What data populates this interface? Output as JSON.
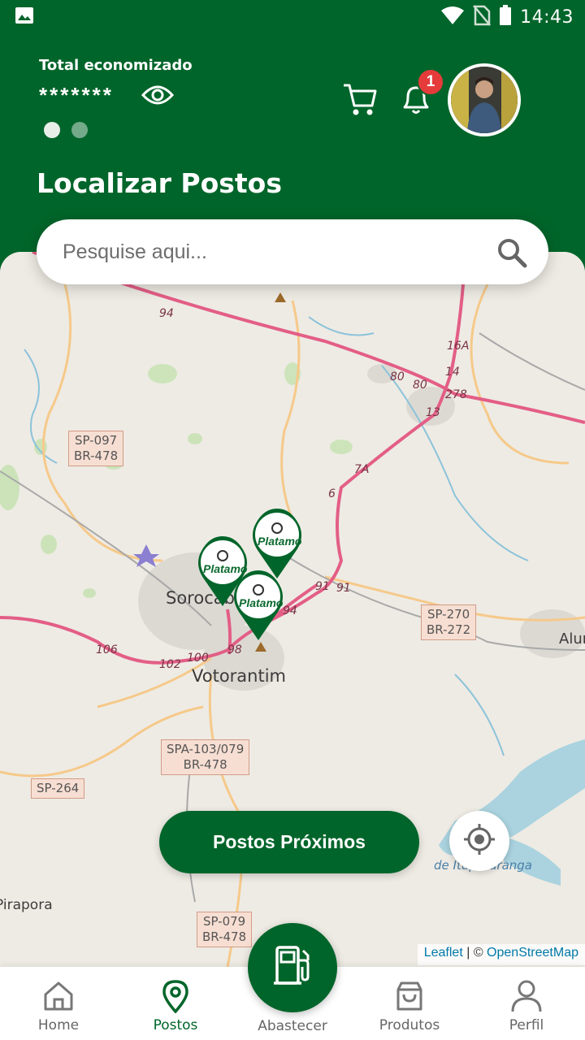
{
  "status_bar": {
    "time": "14:43"
  },
  "header": {
    "saved_label": "Total economizado",
    "saved_value": "*******",
    "notification_count": "1",
    "title": "Localizar Postos"
  },
  "search": {
    "placeholder": "Pesquise aqui..."
  },
  "map": {
    "cities": [
      "Sorocaba",
      "Votorantim",
      "Alum",
      "Pirapora",
      "de Itupararanga"
    ],
    "shields": [
      {
        "line1": "SP-097",
        "line2": "BR-478"
      },
      {
        "line1": "SP-270",
        "line2": "BR-272"
      },
      {
        "line1": "SPA-103/079",
        "line2": "BR-478"
      },
      {
        "line1": "SP-264",
        "line2": ""
      },
      {
        "line1": "SP-079",
        "line2": "BR-478"
      }
    ],
    "road_numbers": [
      "94",
      "80",
      "80",
      "16A",
      "14",
      "13",
      "7A",
      "6",
      "91",
      "91",
      "94",
      "98",
      "100",
      "102",
      "106",
      "278"
    ],
    "pins": [
      "Platamo",
      "Platamo",
      "Platamo"
    ]
  },
  "buttons": {
    "nearby": "Postos Próximos"
  },
  "attribution": {
    "leaflet": "Leaflet",
    "sep": " | © ",
    "osm": "OpenStreetMap"
  },
  "nav": {
    "home": "Home",
    "postos": "Postos",
    "abastecer": "Abastecer",
    "produtos": "Produtos",
    "perfil": "Perfil"
  },
  "colors": {
    "brand_green": "#00652a",
    "badge_red": "#e53b3b"
  }
}
